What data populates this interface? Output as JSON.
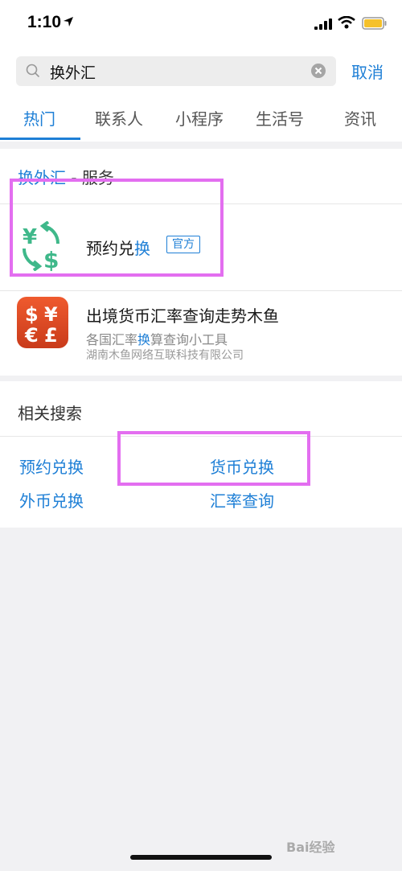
{
  "status_bar": {
    "time": "1:10"
  },
  "search": {
    "query": "换外汇",
    "cancel_label": "取消"
  },
  "tabs": [
    {
      "label": "热门"
    },
    {
      "label": "联系人"
    },
    {
      "label": "小程序"
    },
    {
      "label": "生活号"
    },
    {
      "label": "资讯"
    }
  ],
  "service_section": {
    "title_highlight": "换外汇",
    "title_suffix": " - 服务",
    "items": [
      {
        "title_prefix": "预约兑",
        "title_highlight": "换",
        "badge": "官方"
      },
      {
        "title": "出境货币汇率查询走势木鱼",
        "subtitle_prefix": "各国汇率",
        "subtitle_highlight": "换",
        "subtitle_suffix": "算查询小工具",
        "provider": "湖南木鱼网络互联科技有限公司"
      }
    ]
  },
  "related": {
    "title": "相关搜索",
    "links": [
      "预约兑换",
      "货币兑换",
      "外币兑换",
      "汇率查询"
    ]
  },
  "colors": {
    "accent": "#1e7fd6",
    "annotation": "#e36ef0"
  },
  "watermark": "Bai经验"
}
